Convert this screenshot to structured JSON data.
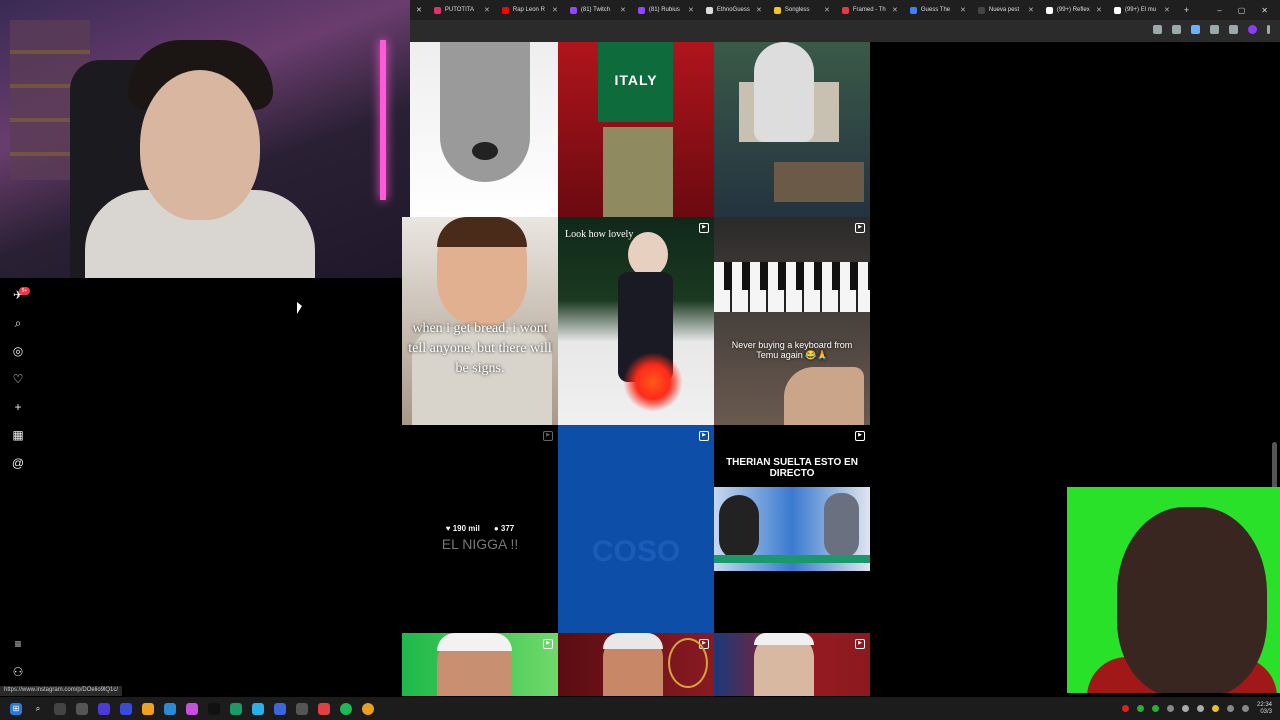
{
  "browser": {
    "tabs": [
      {
        "label": "PUTOTITA",
        "color": "#e1306c"
      },
      {
        "label": "Rap Leon R",
        "color": "#ff0000"
      },
      {
        "label": "(81) Twitch",
        "color": "#9146ff"
      },
      {
        "label": "(81) Rubius",
        "color": "#9146ff"
      },
      {
        "label": "EthnoGuess",
        "color": "#dddddd"
      },
      {
        "label": "Songless",
        "color": "#f5c518"
      },
      {
        "label": "Framed - Th",
        "color": "#e63946"
      },
      {
        "label": "Guess The",
        "color": "#3b82f6"
      },
      {
        "label": "Nueva pest",
        "color": "#444444"
      },
      {
        "label": "(99+) Reflex",
        "color": "#ffffff"
      },
      {
        "label": "(99+) El mu",
        "color": "#ffffff"
      }
    ],
    "new_tab": "+",
    "window_controls": {
      "minimize": "–",
      "maximize": "▢",
      "close": "✕"
    },
    "status_url": "https://www.instagram.com/p/DOelio9lQ1c/"
  },
  "sidebar": {
    "notification_count": "9+",
    "items": [
      {
        "name": "notifications-icon",
        "glyph": "✈"
      },
      {
        "name": "search-icon",
        "glyph": "⌕"
      },
      {
        "name": "explore-icon",
        "glyph": "◎"
      },
      {
        "name": "heart-icon",
        "glyph": "♡"
      },
      {
        "name": "create-icon",
        "glyph": "+"
      },
      {
        "name": "dashboard-icon",
        "glyph": "▦"
      },
      {
        "name": "threads-icon",
        "glyph": "@"
      }
    ],
    "bottom": [
      {
        "name": "menu-icon",
        "glyph": "≡"
      },
      {
        "name": "meta-icon",
        "glyph": "⚇"
      }
    ]
  },
  "grid": {
    "tiles": [
      {
        "caption": ""
      },
      {
        "caption": "ITALY"
      },
      {
        "caption": ""
      },
      {
        "caption": "when i get bread, i wont tell anyone, but there will be signs."
      },
      {
        "caption": "Look how lovely"
      },
      {
        "caption": "Never buying a keyboard from Temu again 😂🙏"
      },
      {
        "caption": "EL NIGGA !!",
        "likes": "190 mil",
        "comments": "377"
      },
      {
        "caption": "COSO"
      },
      {
        "caption": "THERIAN SUELTA ESTO EN DIRECTO"
      },
      {
        "caption": ""
      },
      {
        "caption": ""
      },
      {
        "caption": ""
      }
    ]
  },
  "taskbar": {
    "time": "22:34",
    "date": "03/3"
  }
}
